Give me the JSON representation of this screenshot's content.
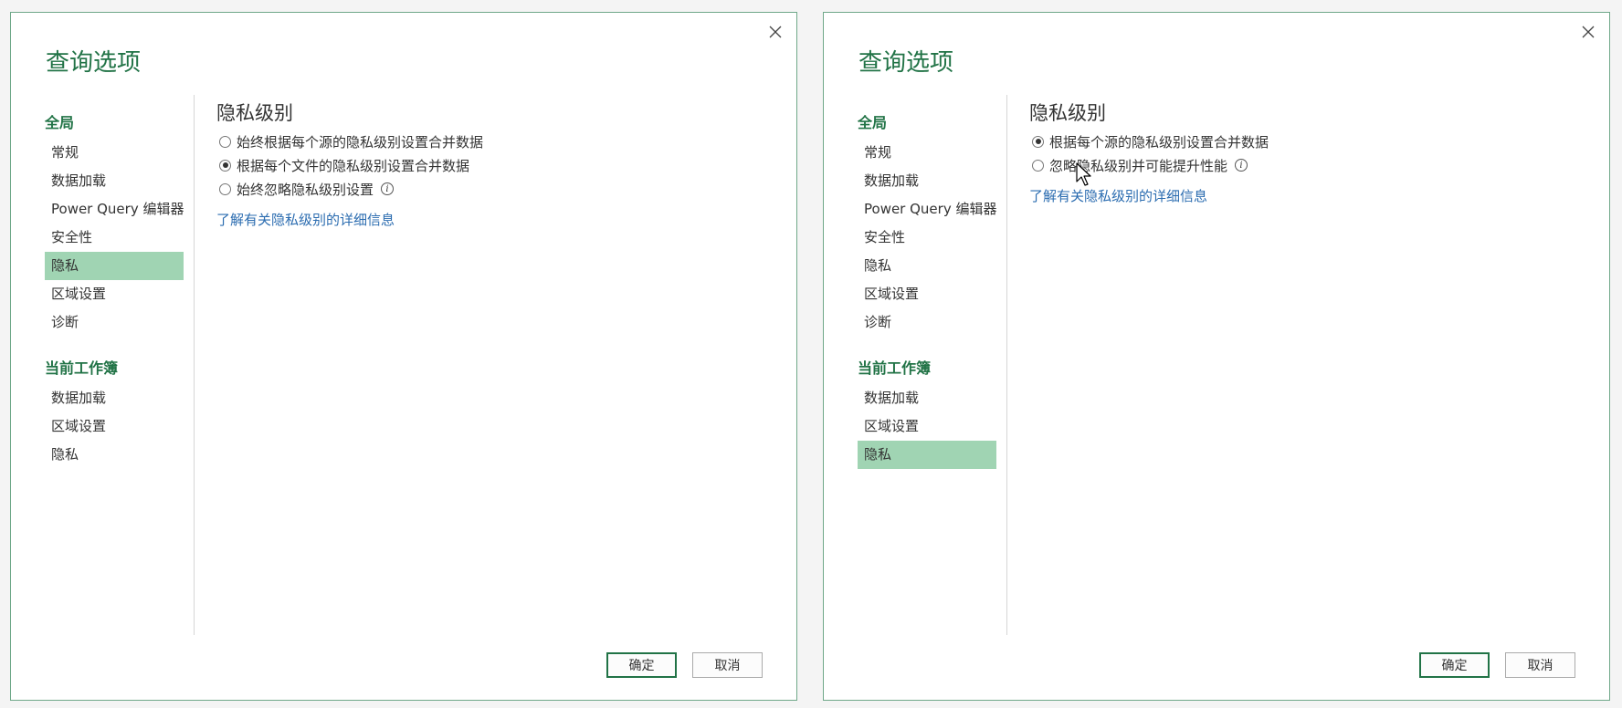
{
  "left_dialog": {
    "title": "查询选项",
    "sidebar": {
      "global_heading": "全局",
      "global_items": [
        "常规",
        "数据加载",
        "Power Query 编辑器",
        "安全性",
        "隐私",
        "区域设置",
        "诊断"
      ],
      "workbook_heading": "当前工作簿",
      "workbook_items": [
        "数据加载",
        "区域设置",
        "隐私"
      ]
    },
    "content": {
      "heading": "隐私级别",
      "options": [
        "始终根据每个源的隐私级别设置合并数据",
        "根据每个文件的隐私级别设置合并数据",
        "始终忽略隐私级别设置"
      ],
      "link": "了解有关隐私级别的详细信息"
    },
    "buttons": {
      "ok": "确定",
      "cancel": "取消"
    }
  },
  "right_dialog": {
    "title": "查询选项",
    "sidebar": {
      "global_heading": "全局",
      "global_items": [
        "常规",
        "数据加载",
        "Power Query 编辑器",
        "安全性",
        "隐私",
        "区域设置",
        "诊断"
      ],
      "workbook_heading": "当前工作簿",
      "workbook_items": [
        "数据加载",
        "区域设置",
        "隐私"
      ]
    },
    "content": {
      "heading": "隐私级别",
      "options": [
        "根据每个源的隐私级别设置合并数据",
        "忽略隐私级别并可能提升性能"
      ],
      "link": "了解有关隐私级别的详细信息"
    },
    "buttons": {
      "ok": "确定",
      "cancel": "取消"
    }
  },
  "colors": {
    "accent": "#217346",
    "selected_nav": "#a0d4b3",
    "link": "#2b6cb0",
    "dialog_border": "#6fa889"
  }
}
